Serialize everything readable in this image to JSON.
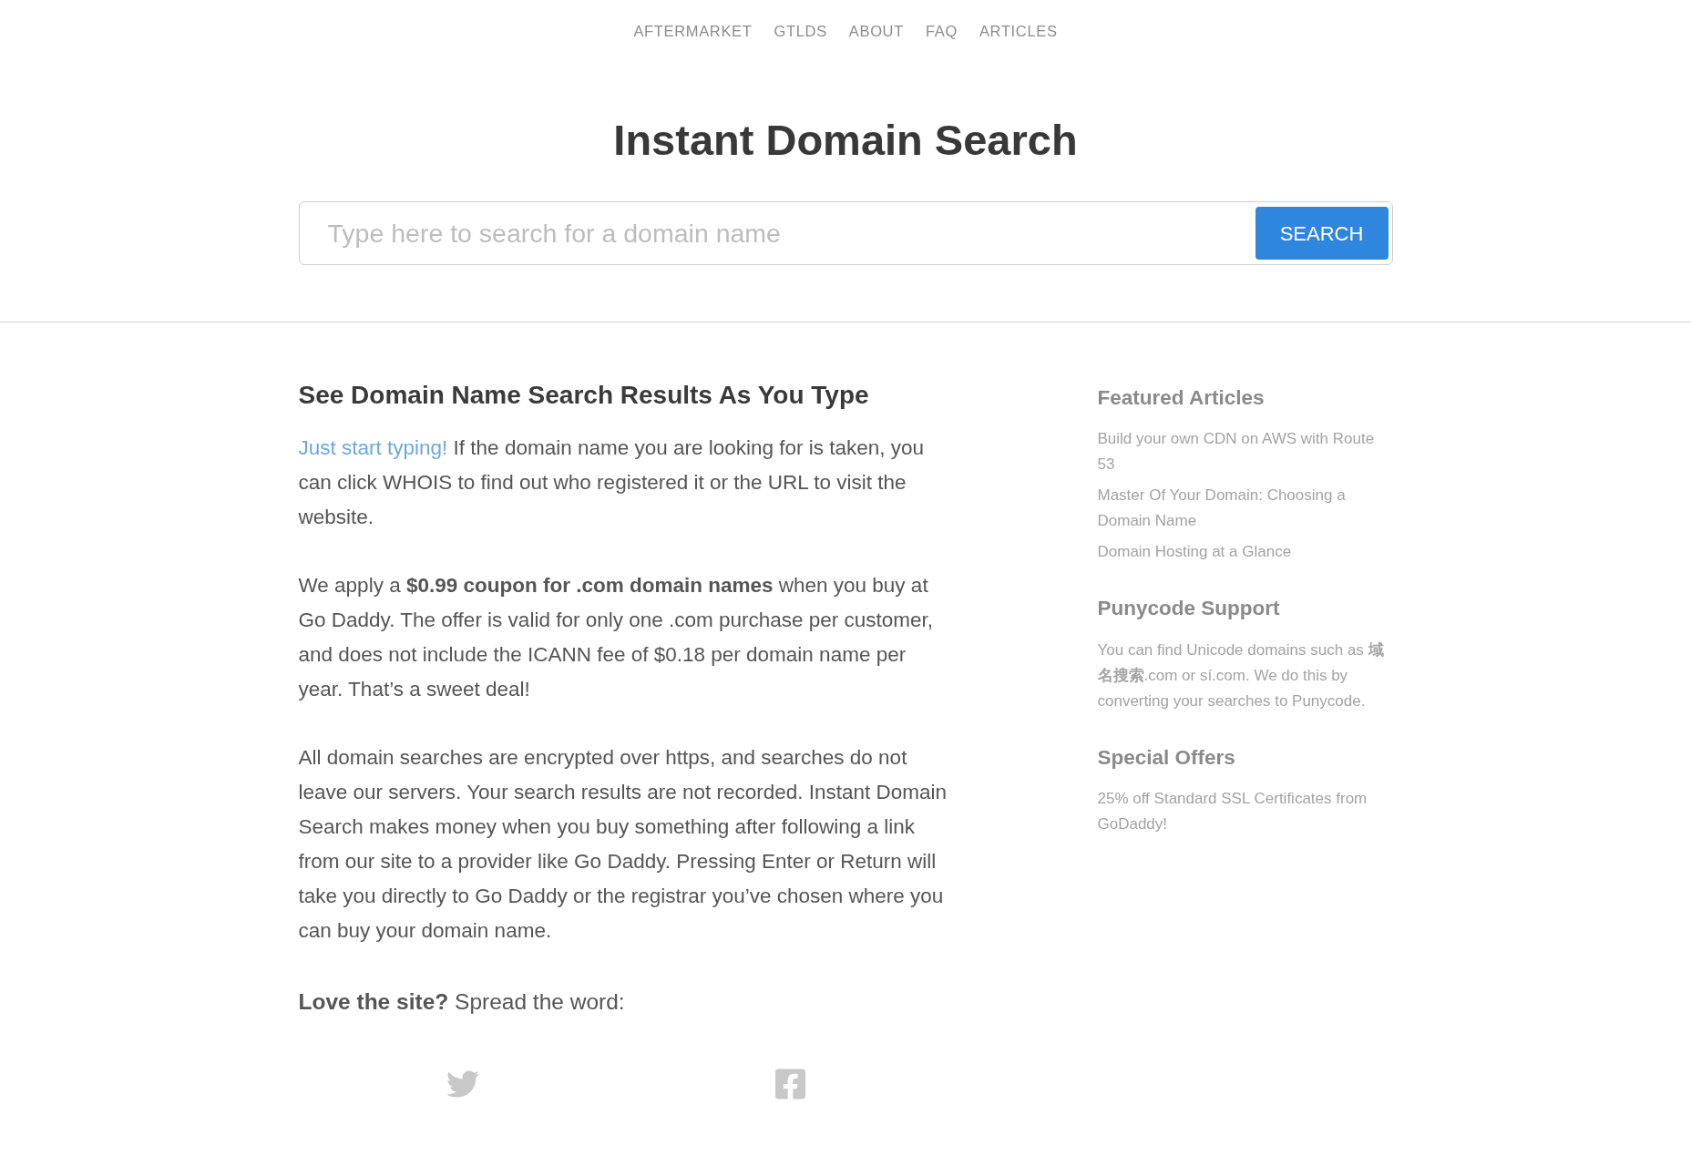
{
  "nav": {
    "items": [
      "AFTERMARKET",
      "GTLDS",
      "ABOUT",
      "FAQ",
      "ARTICLES"
    ]
  },
  "title": "Instant Domain Search",
  "search": {
    "placeholder": "Type here to search for a domain name",
    "button": "SEARCH"
  },
  "main": {
    "heading": "See Domain Name Search Results As You Type",
    "intro": {
      "link": "Just start typing!",
      "text": "If the domain name you are looking for is taken, you can click WHOIS to find out who registered it or the URL to visit the website."
    },
    "paragraphs": [
      "We apply a **$0.99 coupon for .com domain names** when you buy at Go Daddy. The offer is valid for only one .com purchase per customer, and does not include the ICANN fee of $0.18 per domain name per year. That’s a sweet deal!",
      "All domain searches are encrypted over https, and searches do not leave our servers. Your search results are not recorded. Instant Domain Search makes money when you buy something after following a link from our site to a provider like Go Daddy. Pressing Enter or Return will take you directly to Go Daddy or the registrar you’ve chosen where you can buy your domain name."
    ],
    "share": {
      "text": "**Love the site?** Spread the word:",
      "networks": [
        {
          "kind": "twitter"
        },
        {
          "kind": "facebook"
        }
      ]
    }
  },
  "sidebar": {
    "sections": [
      {
        "kind": "links",
        "title": "Featured Articles",
        "links": [
          "Build your own CDN on AWS with Route 53",
          "Master Of Your Domain: Choosing a Domain Name",
          "Domain Hosting at a Glance"
        ]
      },
      {
        "kind": "text",
        "title": "Punycode Support",
        "text": "You can find Unicode domains such as **域名搜索**.com or sí.com. We do this by converting your searches to Punycode."
      },
      {
        "kind": "links",
        "title": "Special Offers",
        "links": [
          "25% off Standard SSL Certificates from GoDaddy!"
        ]
      }
    ]
  }
}
